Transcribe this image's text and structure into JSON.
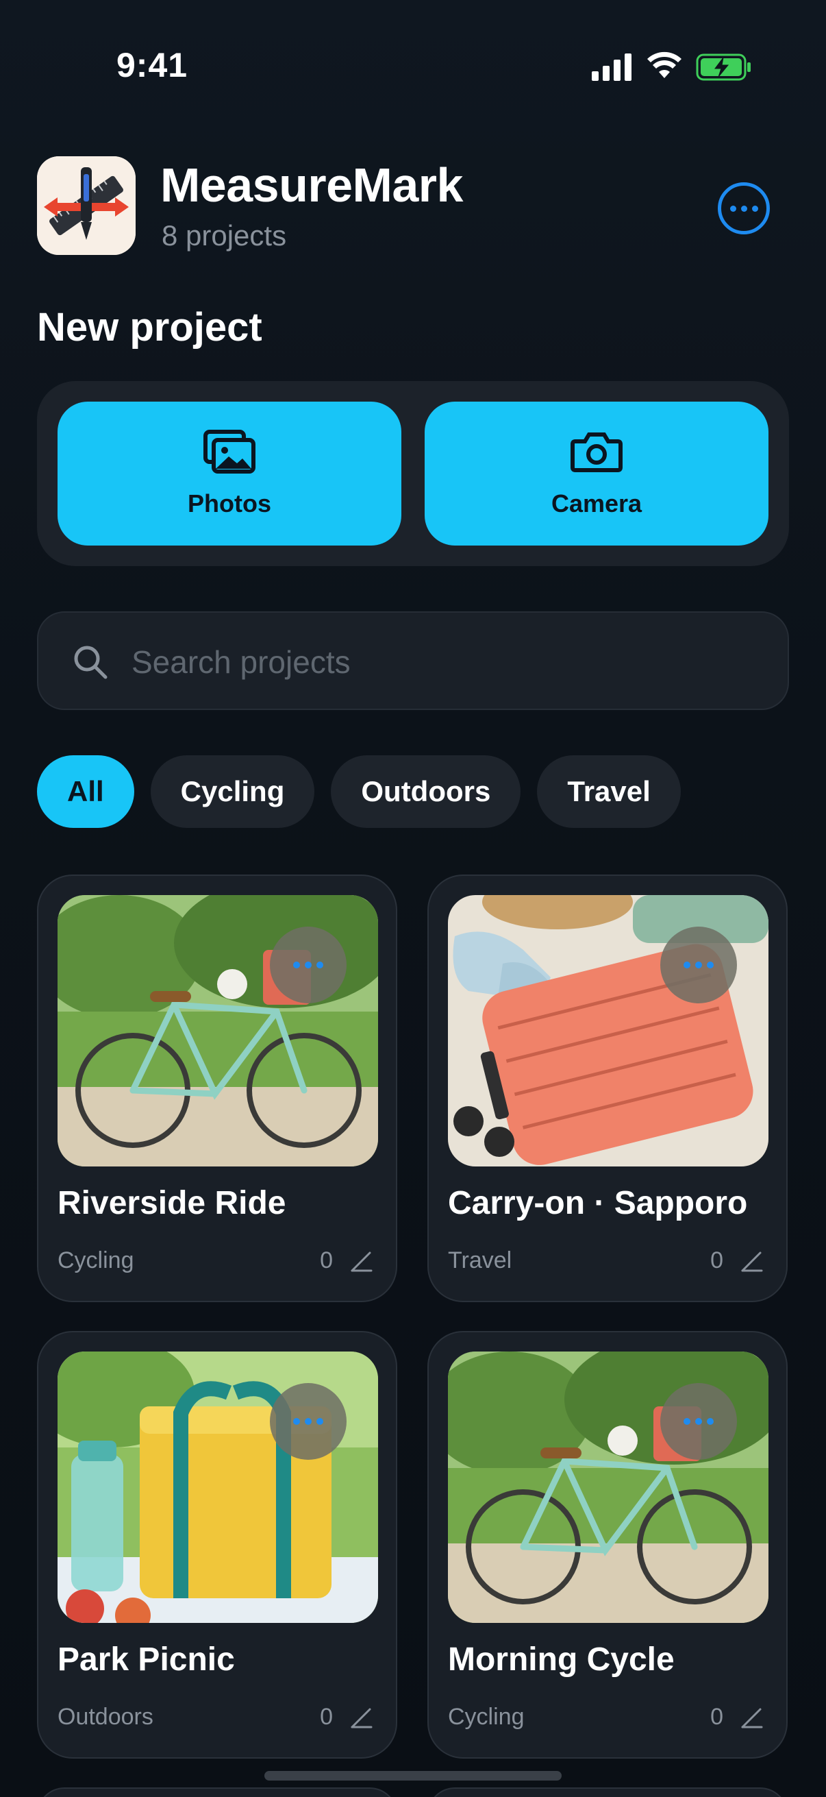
{
  "status_bar": {
    "time": "9:41"
  },
  "header": {
    "app_name": "MeasureMark",
    "project_count": "8 projects"
  },
  "new_project": {
    "title": "New project",
    "photos_label": "Photos",
    "camera_label": "Camera"
  },
  "search": {
    "placeholder": "Search projects",
    "value": ""
  },
  "filters": {
    "items": [
      {
        "label": "All",
        "selected": true
      },
      {
        "label": "Cycling",
        "selected": false
      },
      {
        "label": "Outdoors",
        "selected": false
      },
      {
        "label": "Travel",
        "selected": false
      }
    ]
  },
  "projects": [
    {
      "title": "Riverside Ride",
      "category": "Cycling",
      "count": "0",
      "image": "bicycle"
    },
    {
      "title": "Carry-on · Sapporo",
      "category": "Travel",
      "count": "0",
      "image": "suitcase"
    },
    {
      "title": "Park Picnic",
      "category": "Outdoors",
      "count": "0",
      "image": "cooler-bag"
    },
    {
      "title": "Morning Cycle",
      "category": "Cycling",
      "count": "0",
      "image": "bicycle"
    }
  ],
  "colors": {
    "accent": "#18c5f7",
    "link_blue": "#1e8bf0",
    "background": "#0d141c",
    "card": "#191f27",
    "muted_text": "#8a929c"
  }
}
